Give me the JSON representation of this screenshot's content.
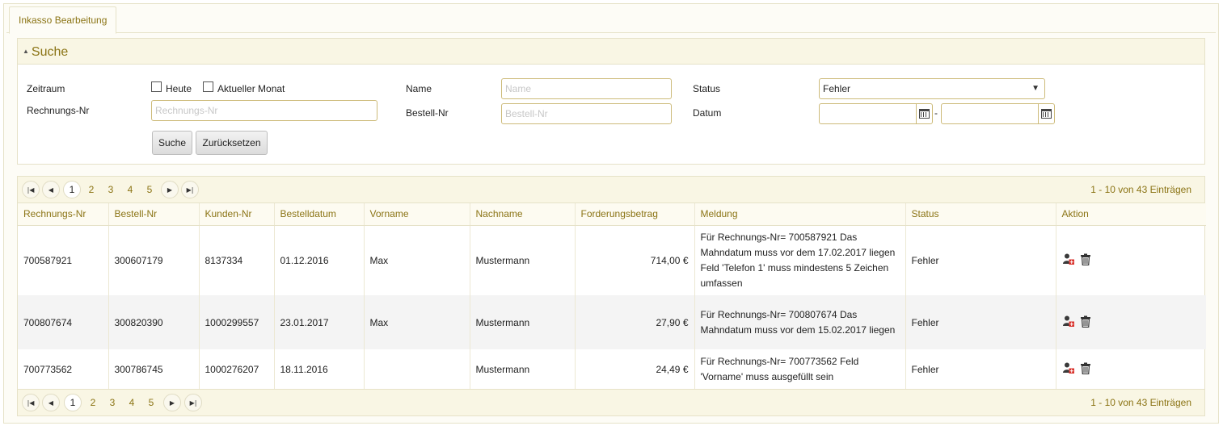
{
  "tab": {
    "label": "Inkasso Bearbeitung"
  },
  "search": {
    "title": "Suche",
    "zeitraum_label": "Zeitraum",
    "heute_label": "Heute",
    "monat_label": "Aktueller Monat",
    "rechnungsnr_label": "Rechnungs-Nr",
    "rechnungsnr_placeholder": "Rechnungs-Nr",
    "name_label": "Name",
    "name_placeholder": "Name",
    "bestellnr_label": "Bestell-Nr",
    "bestellnr_placeholder": "Bestell-Nr",
    "status_label": "Status",
    "status_value": "Fehler",
    "datum_label": "Datum",
    "datum_separator": "-",
    "suche_button": "Suche",
    "reset_button": "Zurücksetzen"
  },
  "pager": {
    "pages": [
      "1",
      "2",
      "3",
      "4",
      "5"
    ],
    "info": "1 - 10 von 43 Einträgen"
  },
  "table": {
    "columns": [
      "Rechnungs-Nr",
      "Bestell-Nr",
      "Kunden-Nr",
      "Bestelldatum",
      "Vorname",
      "Nachname",
      "Forderungsbetrag",
      "Meldung",
      "Status",
      "Aktion"
    ],
    "rows": [
      {
        "rechnungsnr": "700587921",
        "bestellnr": "300607179",
        "kundennr": "8137334",
        "datum": "01.12.2016",
        "vorname": "Max",
        "nachname": "Mustermann",
        "betrag": "714,00 €",
        "meldung": "Für Rechnungs-Nr= 700587921 Das Mahndatum muss vor dem 17.02.2017 liegen Feld 'Telefon 1' muss mindestens 5 Zeichen umfassen",
        "status": "Fehler"
      },
      {
        "rechnungsnr": "700807674",
        "bestellnr": "300820390",
        "kundennr": "1000299557",
        "datum": "23.01.2017",
        "vorname": "Max",
        "nachname": "Mustermann",
        "betrag": "27,90 €",
        "meldung": "Für Rechnungs-Nr= 700807674 Das Mahndatum muss vor dem 15.02.2017 liegen",
        "status": "Fehler"
      },
      {
        "rechnungsnr": "700773562",
        "bestellnr": "300786745",
        "kundennr": "1000276207",
        "datum": "18.11.2016",
        "vorname": "",
        "nachname": "Mustermann",
        "betrag": "24,49 €",
        "meldung": "Für Rechnungs-Nr= 700773562 Feld 'Vorname' muss ausgefüllt sein",
        "status": "Fehler"
      }
    ]
  },
  "icons": [
    "user-edit-icon",
    "trash-icon",
    "calendar-icon",
    "first-page-icon",
    "prev-page-icon",
    "next-page-icon",
    "last-page-icon"
  ]
}
